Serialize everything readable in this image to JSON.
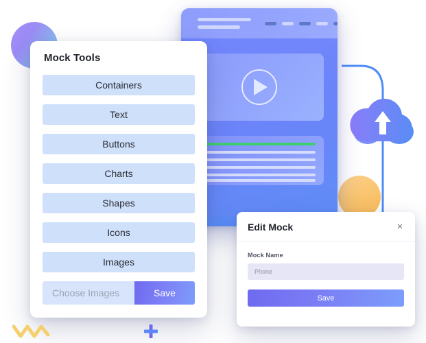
{
  "decor": {
    "gradient_circle": "gradient-circle",
    "orange_circle": "orange-circle",
    "zigzag_color": "#f4cf6b",
    "plus_color": "#6f6af0",
    "cloud_color": "#5b86f7"
  },
  "mock_preview": {
    "name": "mock-preview-browser",
    "nav_dashes": [
      "dark",
      "light",
      "dark",
      "light",
      "dark"
    ],
    "play_button": "play-icon",
    "accent_green": "#3fce6f",
    "text_line_count": 5
  },
  "tools_panel": {
    "title": "Mock Tools",
    "items": [
      {
        "label": "Containers"
      },
      {
        "label": "Text"
      },
      {
        "label": "Buttons"
      },
      {
        "label": "Charts"
      },
      {
        "label": "Shapes"
      },
      {
        "label": "Icons"
      },
      {
        "label": "Images"
      }
    ],
    "file_field": {
      "placeholder": "Choose Images",
      "value": ""
    },
    "save_label": "Save"
  },
  "edit_dialog": {
    "title": "Edit Mock",
    "close_icon": "×",
    "field_label": "Mock Name",
    "field_placeholder": "Phone",
    "field_value": "",
    "save_label": "Save"
  }
}
